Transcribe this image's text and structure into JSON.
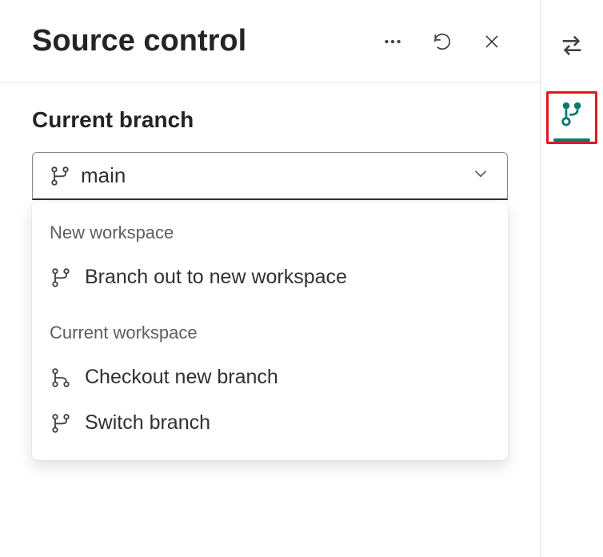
{
  "header": {
    "title": "Source control"
  },
  "section": {
    "label": "Current branch",
    "selected": "main"
  },
  "menu": {
    "groups": [
      {
        "label": "New workspace",
        "items": [
          {
            "icon": "branch",
            "text": "Branch out to new workspace"
          }
        ]
      },
      {
        "label": "Current workspace",
        "items": [
          {
            "icon": "checkout",
            "text": "Checkout new branch"
          },
          {
            "icon": "branch",
            "text": "Switch branch"
          }
        ]
      }
    ]
  }
}
